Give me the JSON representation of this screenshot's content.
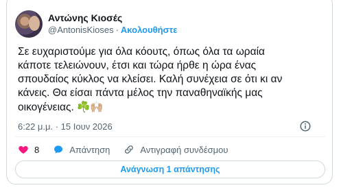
{
  "author": {
    "display_name": "Αντώνης Κιοσές",
    "handle": "@AntonisKioses",
    "separator": "·",
    "follow_label": "Ακολουθήστε"
  },
  "tweet": {
    "text": "Σε ευχαριστούμε για όλα κόουτς, όπως όλα τα ωραία\nκάποτε τελειώνουν, έτσι και τώρα ήρθε η ώρα ένας\nσπουδαίος κύκλος να κλείσει. Καλή συνέχεια σε ότι κι αν\nκάνεις. Θα είσαι πάντα μέλος την παναθηναϊκής μας\nοικογένειας. ",
    "emoji_clover": "☘️",
    "emoji_hands": "🙌🏼",
    "timestamp": "6:22 μ.μ. · 15 Ιουν 2026"
  },
  "actions": {
    "like_count": "8",
    "reply_label": "Απάντηση",
    "copy_link_label": "Αντιγραφή συνδέσμου"
  },
  "read_replies_label": "Ανάγνωση 1 απάντησης",
  "colors": {
    "accent": "#1d9bf0",
    "like": "#f91880",
    "muted": "#536471",
    "border": "#cfd9de"
  }
}
